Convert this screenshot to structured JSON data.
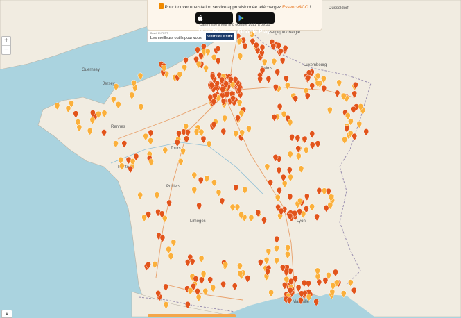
{
  "banner": {
    "text_before": "Pour trouver une station service approvisionnée téléchargez ",
    "brand": "Essence&CO",
    "text_after": " !",
    "apple_small": "Téléchargez dans",
    "apple_big": "l'App Store",
    "google_small": "GET IT ON",
    "google_big": "Google Play",
    "updated": "Carte mise à jour le 8 octobre 2022 à 09:51"
  },
  "ad": {
    "brand": "Bosch EXPERT",
    "text": "Les meilleurs outils pour vous",
    "button": "VISITER LE SITE"
  },
  "zoom": {
    "in": "+",
    "out": "−"
  },
  "corner_toggle": "∨",
  "map_labels": {
    "guernsey": "Guernsey",
    "jersey": "Jersey",
    "belgique": "Belgique / België",
    "dusseldorf": "Düsseldorf",
    "luxembourg": "Luxembourg",
    "reims": "Reims",
    "rennes": "Rennes",
    "nantes": "Nantes",
    "poitiers": "Poitiers",
    "limoges": "Limoges",
    "tours": "Tours",
    "lyon": "Lyon",
    "marseille": "Marseille"
  },
  "colors": {
    "sea": "#aad3df",
    "land": "#f1ece1",
    "marker_orange": "#fbb03b",
    "marker_red": "#e2541b",
    "brand": "#e8731a"
  }
}
